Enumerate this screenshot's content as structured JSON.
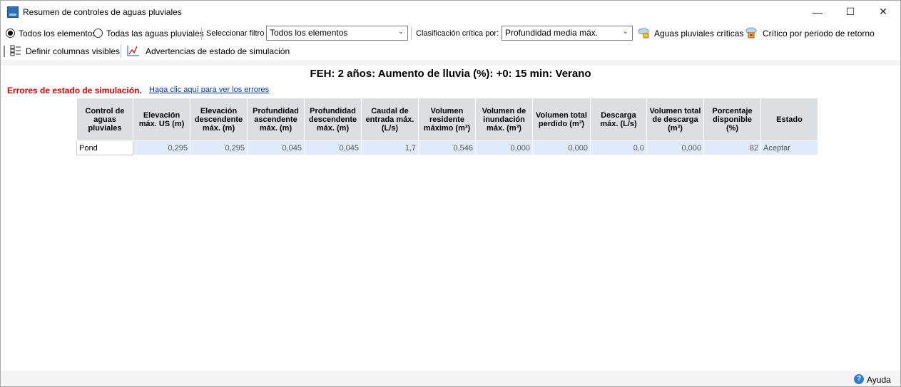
{
  "window": {
    "title": "Resumen de controles de aguas pluviales",
    "controls": {
      "minimize": "—",
      "maximize": "☐",
      "close": "✕"
    }
  },
  "toolbar": {
    "radio_all_elements": "Todos los elementos",
    "radio_all_stormwater": "Todas las aguas pluviales",
    "select_filter_label": "Seleccionar filtro",
    "filter_value": "Todos los elementos",
    "critical_label": "Clasificación crítica por:",
    "critical_value": "Profundidad media máx.",
    "critical_stormwater": "Aguas pluviales críticas",
    "critical_return": "Crítico por periodo de retorno",
    "define_columns": "Definir columnas visibles",
    "sim_warnings": "Advertencias de estado de simulación"
  },
  "heading": "FEH: 2 años: Aumento de lluvia (%): +0: 15 min: Verano",
  "errors": {
    "label": "Errores de estado de simulación.",
    "link": "Haga clic aquí para ver los errores"
  },
  "table": {
    "columns": [
      "Control de aguas pluviales",
      "Elevación máx. US (m)",
      "Elevación descendente máx. (m)",
      "Profundidad ascendente máx. (m)",
      "Profundidad descendente máx. (m)",
      "Caudal de entrada máx. (L/s)",
      "Volumen residente máximo (m³)",
      "Volumen de inundación máx. (m³)",
      "Volumen total perdido (m³)",
      "Descarga máx. (L/s)",
      "Volumen total de descarga (m³)",
      "Porcentaje disponible (%)",
      "Estado"
    ],
    "rows": [
      [
        "Pond",
        "0,295",
        "0,295",
        "0,045",
        "0,045",
        "1,7",
        "0,546",
        "0,000",
        "0,000",
        "0,0",
        "0,000",
        "82",
        "Aceptar"
      ]
    ]
  },
  "footer": {
    "help": "Ayuda"
  }
}
